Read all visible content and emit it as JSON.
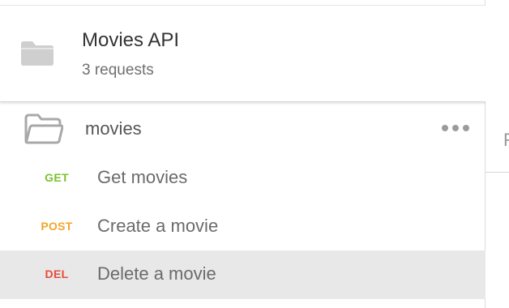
{
  "collection": {
    "name": "Movies API",
    "count": "3 requests"
  },
  "folder": {
    "name": "movies"
  },
  "requests": [
    {
      "method": "GET",
      "name": "Get movies",
      "color": "#7bc22e",
      "selected": false
    },
    {
      "method": "POST",
      "name": "Create a movie",
      "color": "#f3a52b",
      "selected": false
    },
    {
      "method": "DEL",
      "name": "Delete a movie",
      "color": "#e74c3c",
      "selected": true
    }
  ],
  "right_pane": {
    "letter": "F"
  },
  "colors": {
    "selected_row": "#e8e8e8",
    "icon_gray": "#cfcfcf",
    "folder_outline": "#a8a8a8"
  }
}
